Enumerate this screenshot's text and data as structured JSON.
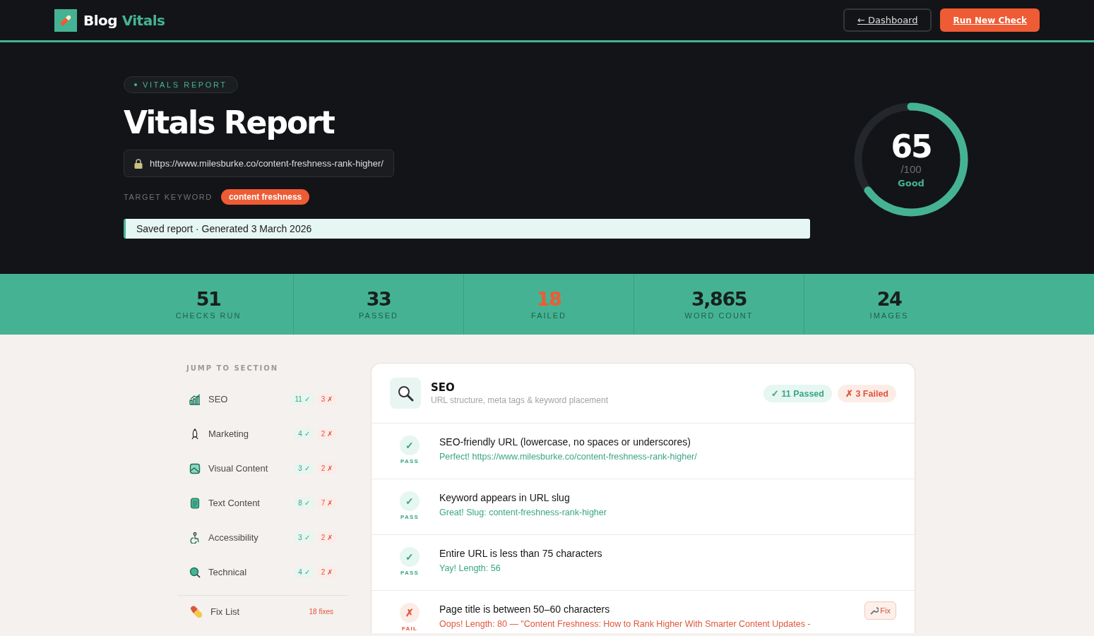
{
  "header": {
    "brand": {
      "first": "Blog",
      "second": "Vitals"
    },
    "buttons": [
      {
        "label": "← Dashboard",
        "kind": "outline"
      },
      {
        "label": "Run New Check",
        "kind": "primary"
      }
    ]
  },
  "hero": {
    "eyebrow": "VITALS REPORT",
    "title": "Vitals Report",
    "url": "https://www.milesburke.co/content-freshness-rank-higher/",
    "keyword_label": "TARGET KEYWORD",
    "keyword": "content freshness",
    "notice": "Saved report · Generated 3 March 2026",
    "score": {
      "value": "65",
      "out_of": "/100",
      "rating": "Good",
      "level": 0.65
    }
  },
  "stats": [
    {
      "value": "51",
      "label": "CHECKS RUN",
      "kind": "normal"
    },
    {
      "value": "33",
      "label": "PASSED",
      "kind": "normal"
    },
    {
      "value": "18",
      "label": "FAILED",
      "kind": "alert"
    },
    {
      "value": "3,865",
      "label": "WORD COUNT",
      "kind": "normal"
    },
    {
      "value": "24",
      "label": "IMAGES",
      "kind": "normal"
    }
  ],
  "sidebar": {
    "heading": "JUMP TO SECTION",
    "items": [
      {
        "label": "SEO",
        "kind": "chart",
        "passed": "11 ✓",
        "failed": "3 ✗"
      },
      {
        "label": "Marketing",
        "kind": "rocket",
        "passed": "4 ✓",
        "failed": "2 ✗"
      },
      {
        "label": "Visual Content",
        "kind": "image",
        "passed": "3 ✓",
        "failed": "2 ✗"
      },
      {
        "label": "Text Content",
        "kind": "document",
        "passed": "8 ✓",
        "failed": "7 ✗"
      },
      {
        "label": "Accessibility",
        "kind": "person",
        "passed": "3 ✓",
        "failed": "2 ✗"
      },
      {
        "label": "Technical",
        "kind": "magnifier",
        "passed": "4 ✓",
        "failed": "2 ✗"
      }
    ],
    "fix_list": {
      "label": "Fix List",
      "count": "18 fixes"
    }
  },
  "section": {
    "title": "SEO",
    "subtitle": "URL structure, meta tags & keyword placement",
    "passed": "✓ 11 Passed",
    "failed": "✗ 3 Failed",
    "checks": [
      {
        "kind": "pass",
        "mark": "✓",
        "status_label": "PASS",
        "title": "SEO-friendly URL (lowercase, no spaces or underscores)",
        "detail": "Perfect! https://www.milesburke.co/content-freshness-rank-higher/"
      },
      {
        "kind": "pass",
        "mark": "✓",
        "status_label": "PASS",
        "title": "Keyword appears in URL slug",
        "detail": "Great! Slug: content-freshness-rank-higher"
      },
      {
        "kind": "pass",
        "mark": "✓",
        "status_label": "PASS",
        "title": "Entire URL is less than 75 characters",
        "detail": "Yay! Length: 56"
      },
      {
        "kind": "fail",
        "mark": "✗",
        "status_label": "FAIL",
        "title": "Page title is between 50–60 characters",
        "detail": "Oops! Length: 80 — \"Content Freshness: How to Rank Higher With Smarter Content Updates -",
        "fix": "Fix"
      }
    ]
  }
}
